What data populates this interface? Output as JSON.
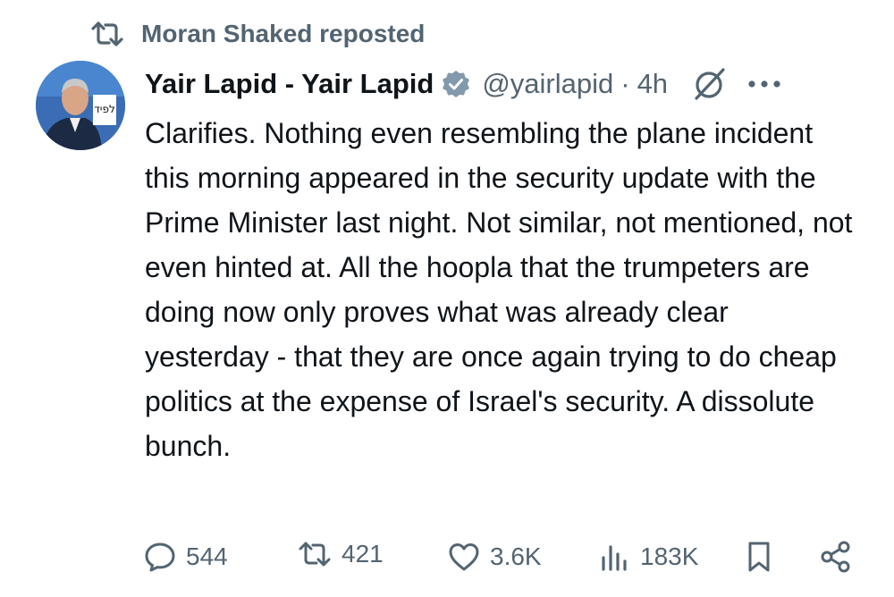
{
  "repost": {
    "text": "Moran Shaked reposted",
    "icon": "repost-icon"
  },
  "tweet": {
    "author_name": "Yair Lapid - Yair Lapid",
    "handle": "@yairlapid",
    "separator": "·",
    "time": "4h",
    "body": "Clarifies. Nothing even resembling the plane incident this morning appeared in the security update with the Prime Minister last night. Not similar, not mentioned, not even hinted at. All the hoopla that the trumpeters are doing now only proves what was already clear yesterday - that they are once again trying to do cheap politics at the expense of Israel's security. A dissolute bunch.",
    "avatar_sign": "לפיד"
  },
  "actions": {
    "replies": "544",
    "reposts": "421",
    "likes": "3.6K",
    "views": "183K"
  },
  "colors": {
    "text": "#0f1419",
    "muted": "#536471",
    "verified": "#829aab"
  }
}
